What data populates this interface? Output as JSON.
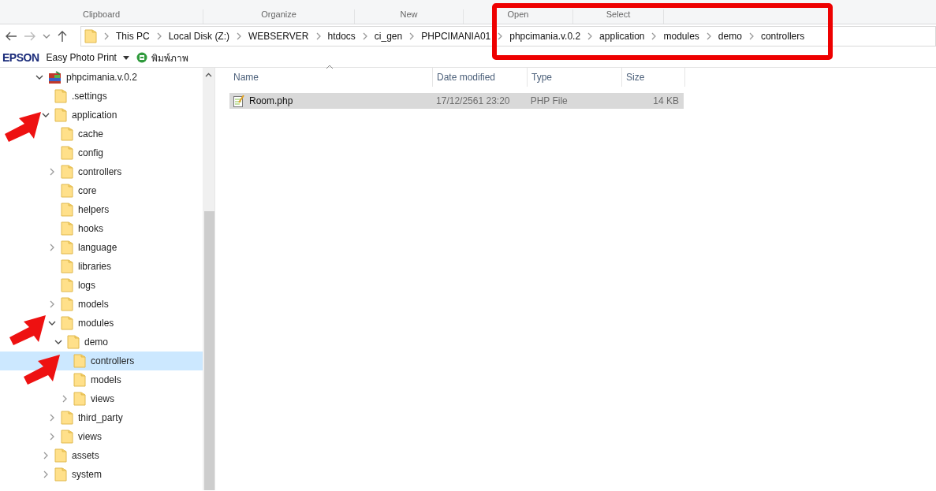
{
  "ribbon_groups": [
    "Clipboard",
    "Organize",
    "New",
    "Open",
    "Select"
  ],
  "address_bar": {
    "crumbs": [
      "This PC",
      "Local Disk (Z:)",
      "WEBSERVER",
      "htdocs",
      "ci_gen",
      "PHPCIMANIA01",
      "phpcimania.v.0.2",
      "application",
      "modules",
      "demo",
      "controllers"
    ]
  },
  "toolbar": {
    "brand": "EPSON",
    "app": "Easy Photo Print",
    "print_label": "พิมพ์ภาพ"
  },
  "navigation_tree": [
    {
      "label": "phpcimania.v.0.2",
      "kind": "project",
      "expanded": true,
      "selected": false,
      "children": [
        {
          "label": ".settings",
          "kind": "folder",
          "selected": false
        },
        {
          "label": "application",
          "kind": "folder",
          "expanded": true,
          "selected": false,
          "children": [
            {
              "label": "cache",
              "kind": "folder",
              "selected": false
            },
            {
              "label": "config",
              "kind": "folder",
              "selected": false
            },
            {
              "label": "controllers",
              "kind": "folder",
              "expanded": false,
              "selected": false
            },
            {
              "label": "core",
              "kind": "folder",
              "selected": false
            },
            {
              "label": "helpers",
              "kind": "folder",
              "selected": false
            },
            {
              "label": "hooks",
              "kind": "folder",
              "selected": false
            },
            {
              "label": "language",
              "kind": "folder",
              "expanded": false,
              "selected": false
            },
            {
              "label": "libraries",
              "kind": "folder",
              "selected": false
            },
            {
              "label": "logs",
              "kind": "folder",
              "selected": false
            },
            {
              "label": "models",
              "kind": "folder",
              "expanded": false,
              "selected": false
            },
            {
              "label": "modules",
              "kind": "folder",
              "expanded": true,
              "selected": false,
              "children": [
                {
                  "label": "demo",
                  "kind": "folder",
                  "expanded": true,
                  "selected": false,
                  "children": [
                    {
                      "label": "controllers",
                      "kind": "folder",
                      "selected": true
                    },
                    {
                      "label": "models",
                      "kind": "folder",
                      "selected": false
                    },
                    {
                      "label": "views",
                      "kind": "folder",
                      "expanded": false,
                      "selected": false
                    }
                  ]
                }
              ]
            },
            {
              "label": "third_party",
              "kind": "folder",
              "expanded": false,
              "selected": false
            },
            {
              "label": "views",
              "kind": "folder",
              "expanded": false,
              "selected": false
            }
          ]
        },
        {
          "label": "assets",
          "kind": "folder",
          "expanded": false,
          "selected": false
        },
        {
          "label": "system",
          "kind": "folder",
          "expanded": false,
          "selected": false
        }
      ]
    }
  ],
  "file_list": {
    "columns": [
      "Name",
      "Date modified",
      "Type",
      "Size"
    ],
    "rows": [
      {
        "name": "Room.php",
        "date_modified": "17/12/2561 23:20",
        "type": "PHP File",
        "size": "14 KB",
        "selected": true
      }
    ]
  },
  "annotations": [
    {
      "kind": "frame"
    },
    {
      "kind": "arrow"
    },
    {
      "kind": "arrow"
    },
    {
      "kind": "arrow"
    }
  ]
}
